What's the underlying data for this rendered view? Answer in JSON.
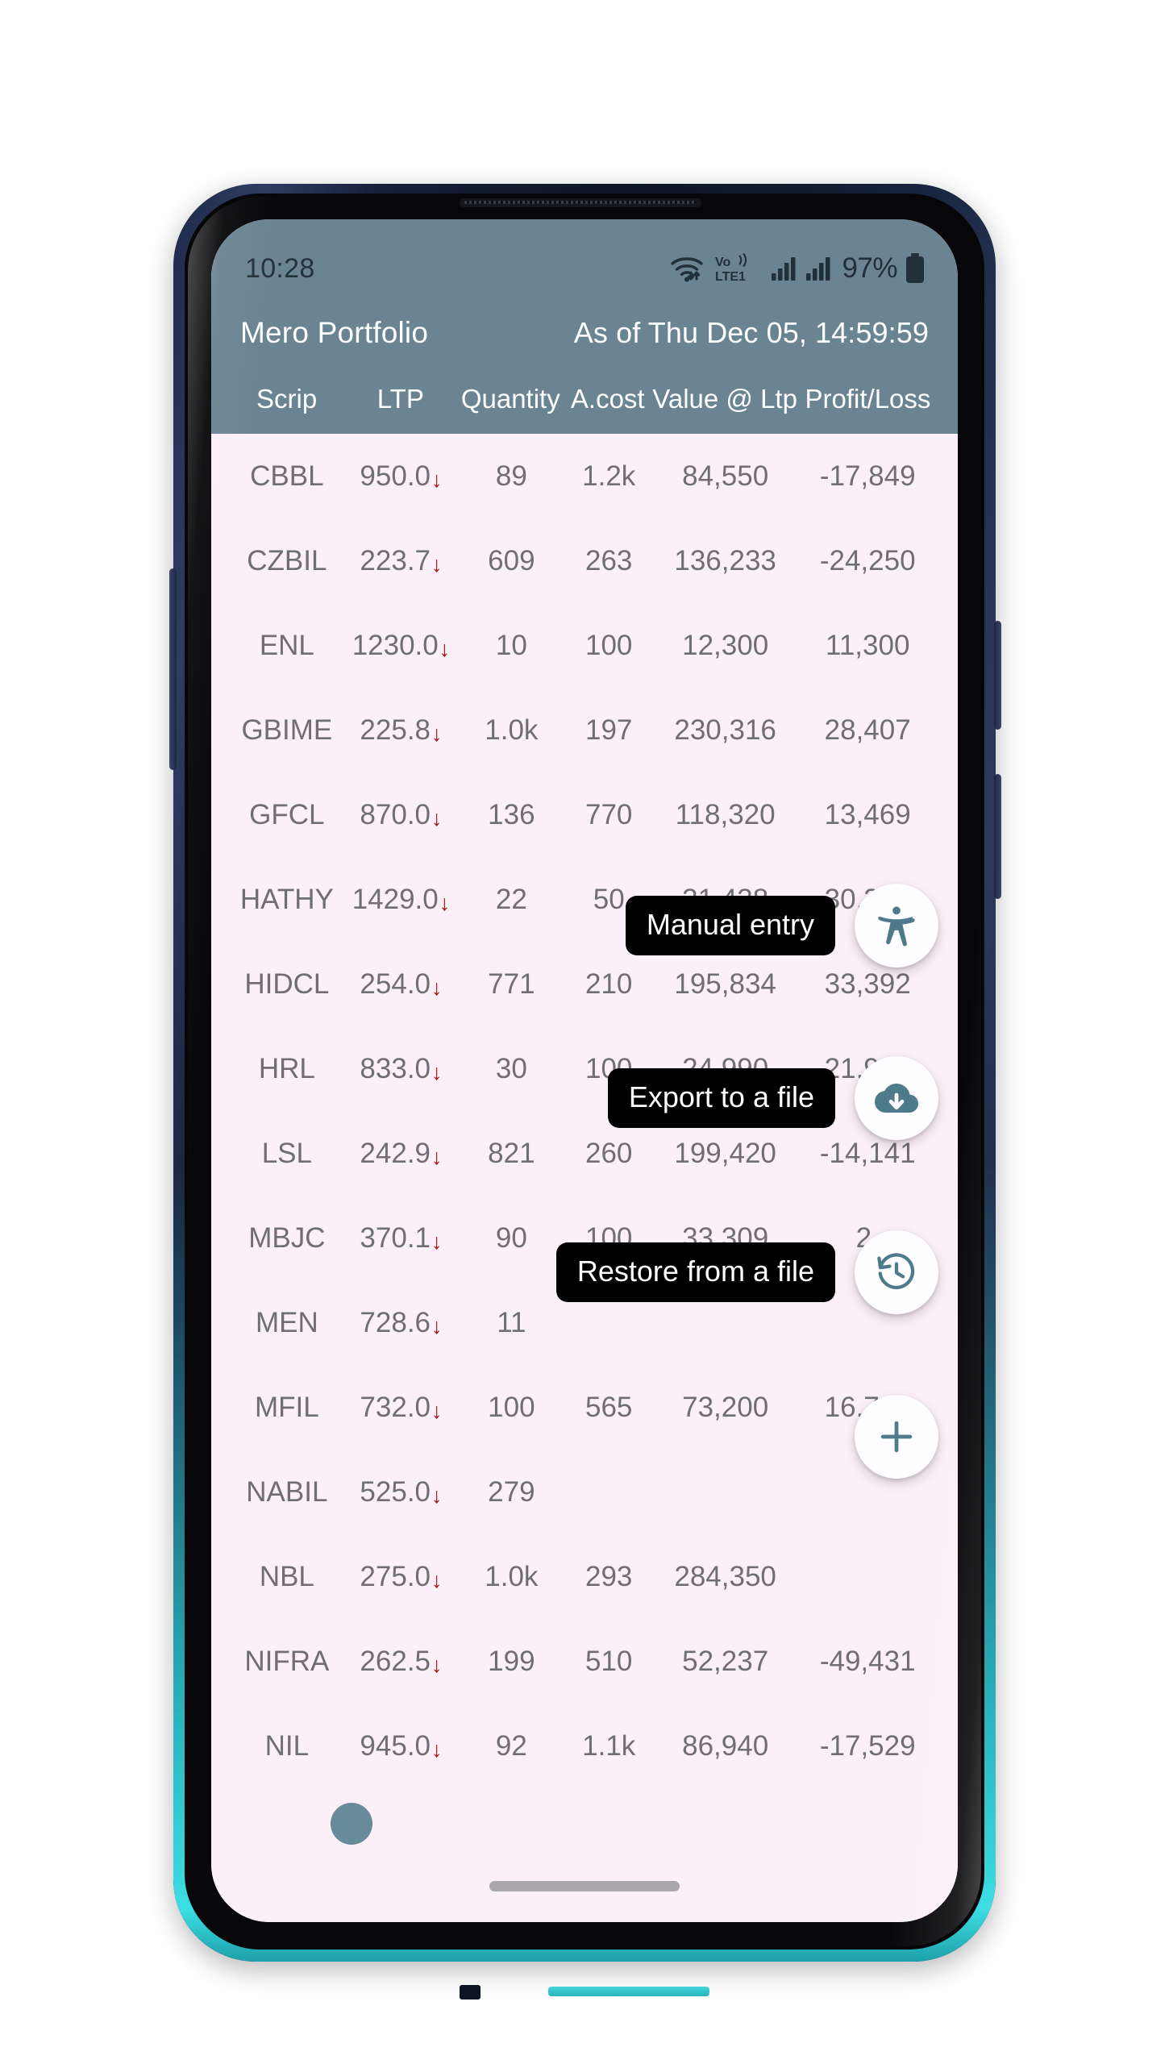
{
  "status_bar": {
    "time": "10:28",
    "battery_percent": "97%",
    "icons": [
      "wifi-icon",
      "volte-icon",
      "signal-bars-sim1-icon",
      "signal-bars-sim2-icon",
      "battery-icon"
    ],
    "volte_label": "Vo)) LTE1",
    "background_color": "#6a8492"
  },
  "app_bar": {
    "title": "Mero Portfolio",
    "as_of": "As of Thu Dec 05, 14:59:59",
    "background_color": "#6a8492",
    "text_color": "#ffffff"
  },
  "table": {
    "columns": [
      "Scrip",
      "LTP",
      "Quantity",
      "A.cost",
      "Value @ Ltp",
      "Profit/Loss"
    ],
    "row_background": "#fbf0f7",
    "text_color": "#6f6f73",
    "down_arrow_color": "#b01015",
    "rows": [
      {
        "scrip": "CBBL",
        "ltp": "950.0",
        "trend": "down",
        "quantity": "89",
        "acost": "1.2k",
        "value": "84,550",
        "pl": "-17,849"
      },
      {
        "scrip": "CZBIL",
        "ltp": "223.7",
        "trend": "down",
        "quantity": "609",
        "acost": "263",
        "value": "136,233",
        "pl": "-24,250"
      },
      {
        "scrip": "ENL",
        "ltp": "1230.0",
        "trend": "down",
        "quantity": "10",
        "acost": "100",
        "value": "12,300",
        "pl": "11,300"
      },
      {
        "scrip": "GBIME",
        "ltp": "225.8",
        "trend": "down",
        "quantity": "1.0k",
        "acost": "197",
        "value": "230,316",
        "pl": "28,407"
      },
      {
        "scrip": "GFCL",
        "ltp": "870.0",
        "trend": "down",
        "quantity": "136",
        "acost": "770",
        "value": "118,320",
        "pl": "13,469"
      },
      {
        "scrip": "HATHY",
        "ltp": "1429.0",
        "trend": "down",
        "quantity": "22",
        "acost": "50",
        "value": "31,438",
        "pl": "30,338"
      },
      {
        "scrip": "HIDCL",
        "ltp": "254.0",
        "trend": "down",
        "quantity": "771",
        "acost": "210",
        "value": "195,834",
        "pl": "33,392"
      },
      {
        "scrip": "HRL",
        "ltp": "833.0",
        "trend": "down",
        "quantity": "30",
        "acost": "100",
        "value": "24,990",
        "pl": "21,990"
      },
      {
        "scrip": "LSL",
        "ltp": "242.9",
        "trend": "down",
        "quantity": "821",
        "acost": "260",
        "value": "199,420",
        "pl": "-14,141"
      },
      {
        "scrip": "MBJC",
        "ltp": "370.1",
        "trend": "down",
        "quantity": "90",
        "acost": "100",
        "value": "33,309",
        "pl": "2,"
      },
      {
        "scrip": "MEN",
        "ltp": "728.6",
        "trend": "down",
        "quantity": "11",
        "acost": "",
        "value": "",
        "pl": ""
      },
      {
        "scrip": "MFIL",
        "ltp": "732.0",
        "trend": "down",
        "quantity": "100",
        "acost": "565",
        "value": "73,200",
        "pl": "16,700"
      },
      {
        "scrip": "NABIL",
        "ltp": "525.0",
        "trend": "down",
        "quantity": "279",
        "acost": "",
        "value": "",
        "pl": ""
      },
      {
        "scrip": "NBL",
        "ltp": "275.0",
        "trend": "down",
        "quantity": "1.0k",
        "acost": "293",
        "value": "284,350",
        "pl": ""
      },
      {
        "scrip": "NIFRA",
        "ltp": "262.5",
        "trend": "down",
        "quantity": "199",
        "acost": "510",
        "value": "52,237",
        "pl": "-49,431"
      },
      {
        "scrip": "NIL",
        "ltp": "945.0",
        "trend": "down",
        "quantity": "92",
        "acost": "1.1k",
        "value": "86,940",
        "pl": "-17,529"
      }
    ]
  },
  "fab_menu": {
    "accent_color": "#4e7b8c",
    "tooltip_background": "#000000",
    "items": [
      {
        "label": "Manual entry",
        "icon": "accessibility-person-icon"
      },
      {
        "label": "Export to a file",
        "icon": "cloud-download-icon"
      },
      {
        "label": "Restore from a file",
        "icon": "history-restore-icon"
      },
      {
        "label": "",
        "icon": "plus-icon"
      }
    ]
  },
  "touch_indicator": {
    "name": "touch-point",
    "color": "#5b8292"
  },
  "gesture_bar": {
    "color": "#a9a7ab"
  }
}
